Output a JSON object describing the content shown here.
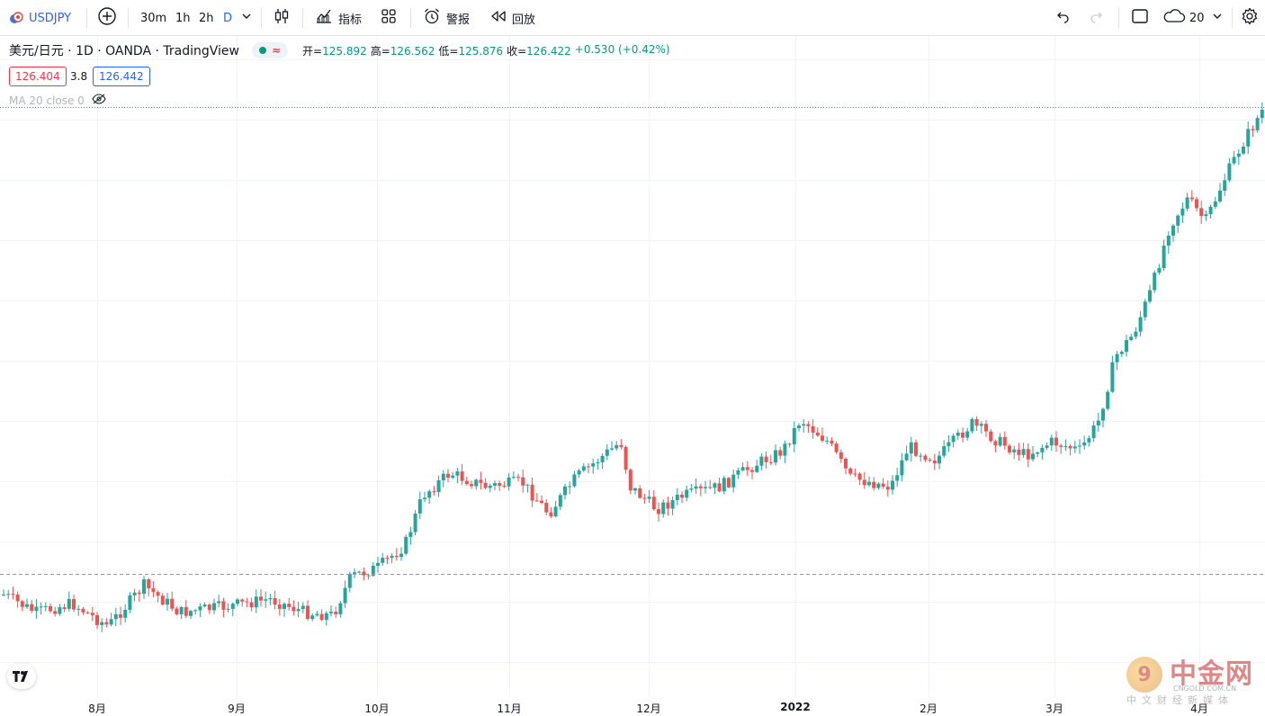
{
  "toolbar": {
    "symbol": "USDJPY",
    "intervals": [
      "30m",
      "1h",
      "2h",
      "D"
    ],
    "active_interval": "D",
    "indicators_label": "指标",
    "alert_label": "警报",
    "replay_label": "回放",
    "cloud_count": "20"
  },
  "legend": {
    "title": "美元/日元 · 1D · OANDA · TradingView",
    "open_label": "开=",
    "open": "125.892",
    "high_label": "高=",
    "high": "126.562",
    "low_label": "低=",
    "low": "125.876",
    "close_label": "收=",
    "close": "126.422",
    "change": "+0.530 (+0.42%)",
    "bid": "126.404",
    "spread": "3.8",
    "ask": "126.442",
    "ma": "MA 20 close 0"
  },
  "axis": {
    "months": [
      "8月",
      "9月",
      "10月",
      "11月",
      "12月",
      "2022",
      "2月",
      "3月",
      "4月"
    ]
  },
  "watermark": {
    "brand": "中金网",
    "url": "CNGOLD.COM.CN",
    "sub": "中文财经新媒体"
  },
  "colors": {
    "up": "#26a69a",
    "down": "#ef5350",
    "accent": "#2962ff",
    "grid": "#f0f3fa"
  },
  "chart_data": {
    "type": "candlestick",
    "symbol": "USDJPY",
    "interval": "1D",
    "x": [
      "2021-07",
      "2021-08",
      "2021-09",
      "2021-10",
      "2021-11",
      "2021-12",
      "2022-01",
      "2022-02",
      "2022-03",
      "2022-04"
    ],
    "x_tick_labels": [
      "8月",
      "9月",
      "10月",
      "11月",
      "12月",
      "2022",
      "2月",
      "3月",
      "4月"
    ],
    "approx_close": [
      110.3,
      109.8,
      110.0,
      113.9,
      114.0,
      113.2,
      115.1,
      115.3,
      121.9,
      126.4
    ],
    "last_bar": {
      "open": 125.892,
      "high": 126.562,
      "low": 125.876,
      "close": 126.422
    }
  }
}
